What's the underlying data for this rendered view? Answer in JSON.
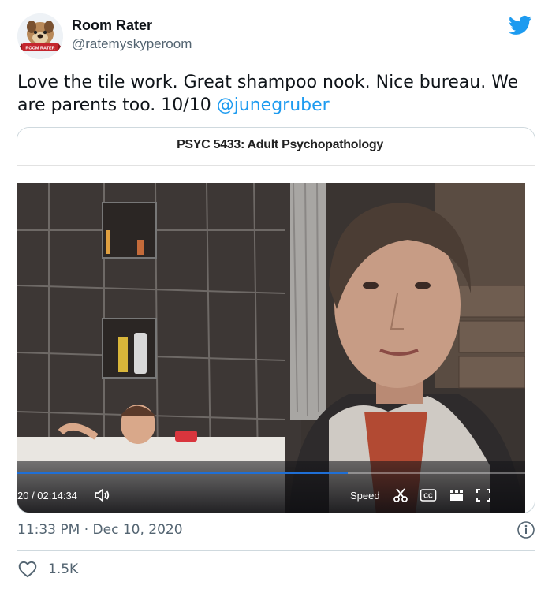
{
  "account": {
    "name": "Room Rater",
    "handle": "@ratemyskyperoom",
    "avatar_caption": "ROOM RATER"
  },
  "tweet": {
    "text_before_mention": "Love the tile work. Great shampoo nook. Nice bureau. We are parents too. 10/10 ",
    "mention": "@junegruber",
    "timestamp": "11:33 PM · Dec 10, 2020",
    "likes": "1.5K"
  },
  "media": {
    "course_title": "PSYC 5433: Adult Psychopathology",
    "time_display": "20 / 02:14:34",
    "speed_label": "Speed",
    "progress_fraction": 0.65
  },
  "icons": {
    "brand": "twitter-bird-icon",
    "volume": "volume-icon",
    "clip": "scissors-icon",
    "captions": "cc-icon",
    "settings": "grid-settings-icon",
    "fullscreen": "fullscreen-icon",
    "info": "info-icon",
    "like": "heart-icon"
  },
  "colors": {
    "link": "#1d9bf0",
    "secondary_text": "#536471",
    "progress": "#1f6fd6"
  }
}
